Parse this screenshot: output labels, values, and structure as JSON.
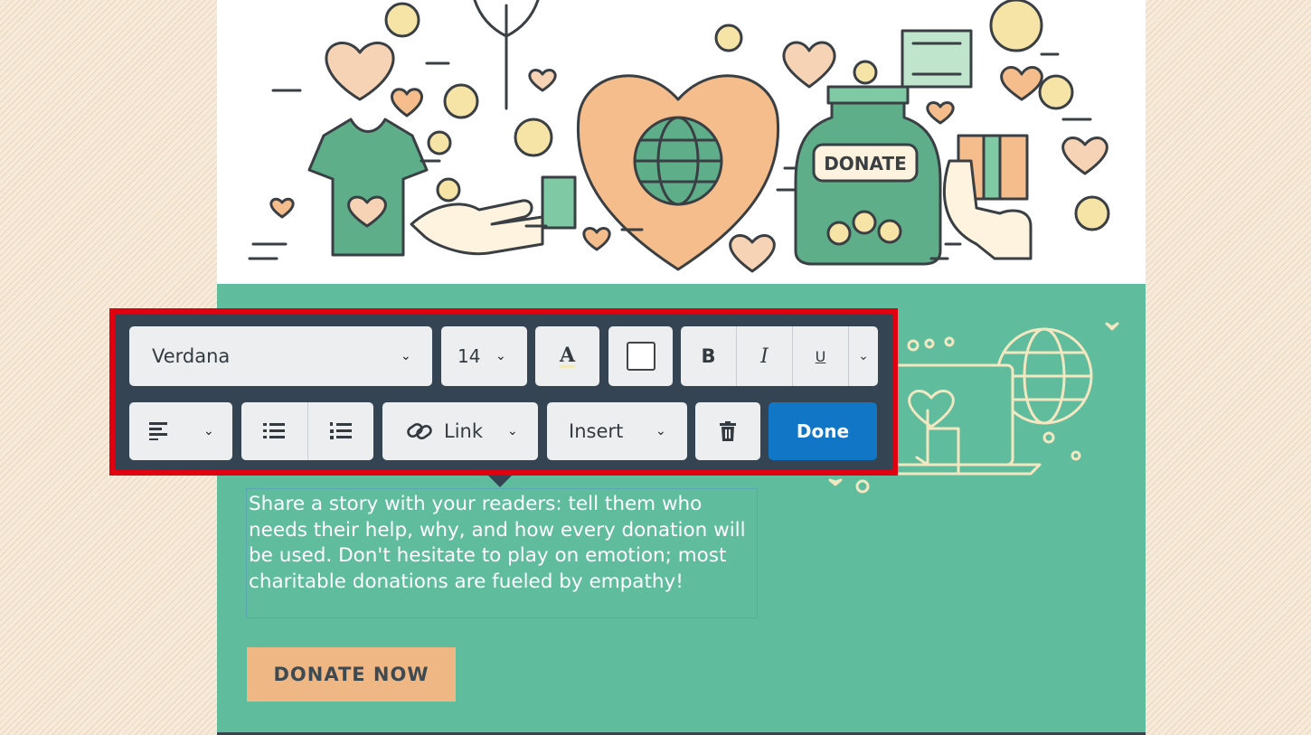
{
  "hero": {
    "jar_label": "DONATE"
  },
  "body": {
    "story_text": "Share a story with your readers: tell them who needs their help, why, and how every donation will be used. Don't hesitate to play on emotion; most charitable donations are fueled by empathy!",
    "donate_button": "DONATE NOW"
  },
  "toolbar": {
    "font_family": "Verdana",
    "font_size": "14",
    "text_color_glyph": "A",
    "bold_glyph": "B",
    "italic_glyph": "I",
    "underline_glyph": "U",
    "link_label": "Link",
    "insert_label": "Insert",
    "done_label": "Done"
  },
  "colors": {
    "accent_blue": "#1176c6",
    "toolbar_bg": "#344452",
    "highlight_frame": "#e10010",
    "section_green": "#5fbc9c",
    "button_peach": "#efb784"
  }
}
